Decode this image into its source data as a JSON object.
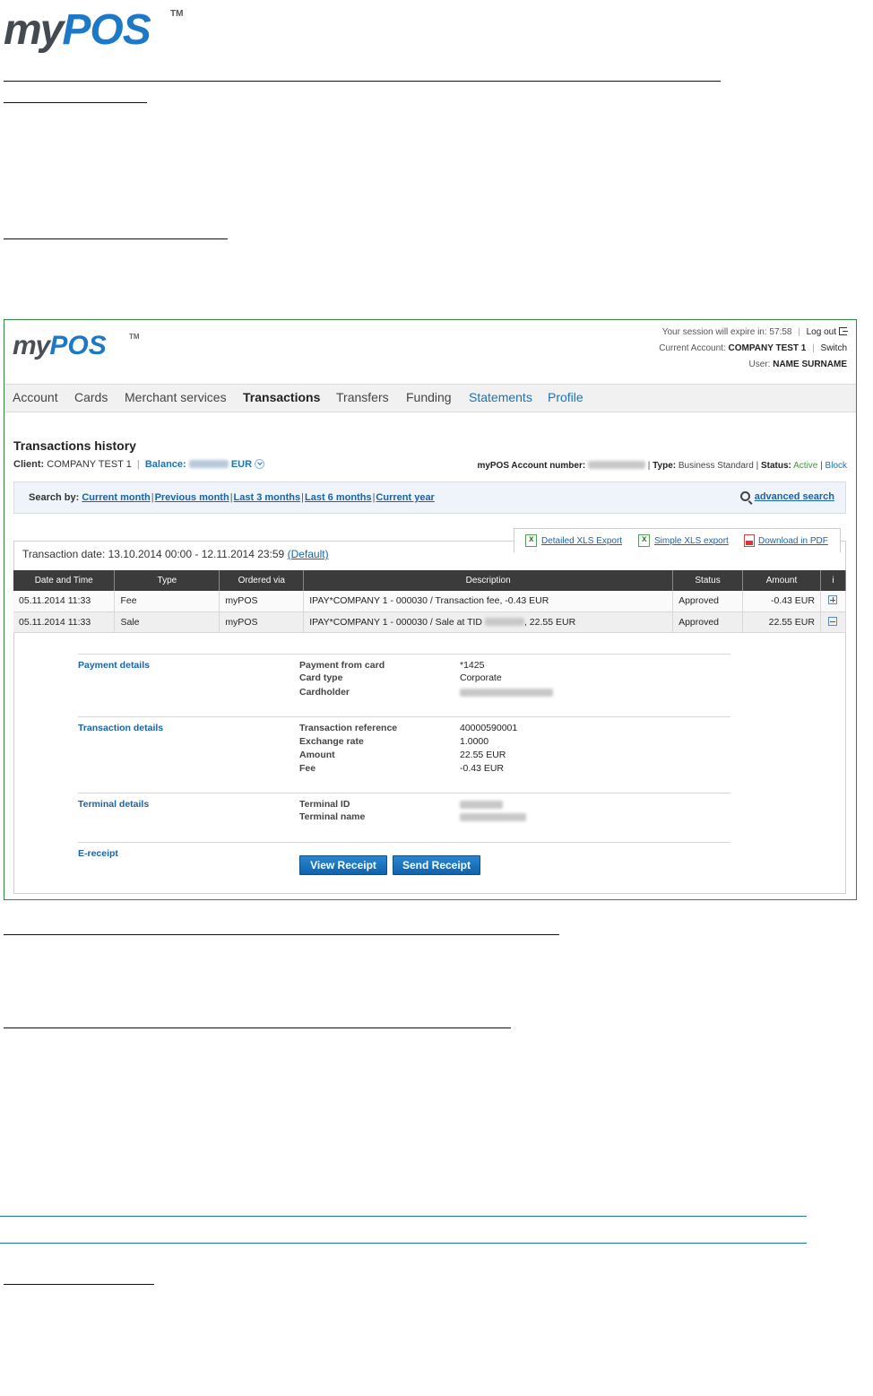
{
  "doc": {
    "logo_my": "my",
    "logo_pos": "POS",
    "logo_tm": "TM"
  },
  "app": {
    "logo_my": "my",
    "logo_pos": "POS",
    "logo_tm": "TM",
    "session": {
      "expire_label": "Your session will expire in:",
      "expire_value": "57:58",
      "logout": "Log out",
      "current_account_label": "Current Account:",
      "current_account": "COMPANY TEST 1",
      "switch": "Switch",
      "user_label": "User:",
      "user": "NAME SURNAME"
    },
    "nav": [
      "Account",
      "Cards",
      "Merchant services",
      "Transactions",
      "Transfers",
      "Funding",
      "Statements",
      "Profile"
    ],
    "page_title": "Transactions history",
    "client": {
      "label": "Client:",
      "value": "COMPANY TEST 1",
      "balance_label": "Balance:",
      "balance_currency": "EUR"
    },
    "account": {
      "number_label": "myPOS Account number:",
      "type_label": "Type:",
      "type": "Business Standard",
      "status_label": "Status:",
      "status": "Active",
      "block": "Block"
    },
    "search": {
      "label": "Search by:",
      "links": [
        "Current month",
        "Previous month",
        "Last 3 months",
        "Last 6 months",
        "Current year"
      ],
      "advanced": "advanced search"
    },
    "exports": {
      "detailed": "Detailed XLS Export",
      "simple": "Simple XLS export",
      "pdf": "Download in PDF"
    },
    "transaction_date": {
      "label": "Transaction date: 13.10.2014 00:00 - 12.11.2014 23:59",
      "default": "(Default)"
    },
    "table": {
      "headers": [
        "Date and Time",
        "Type",
        "Ordered via",
        "Description",
        "Status",
        "Amount",
        "i"
      ],
      "rows": [
        {
          "date": "05.11.2014 11:33",
          "type": "Fee",
          "via": "myPOS",
          "desc": "IPAY*COMPANY 1 - 000030 / Transaction fee, -0.43 EUR",
          "status": "Approved",
          "amount": "-0.43 EUR"
        },
        {
          "date": "05.11.2014 11:33",
          "type": "Sale",
          "via": "myPOS",
          "desc_pre": "IPAY*COMPANY 1 - 000030 / Sale at TID",
          "desc_post": ", 22.55 EUR",
          "status": "Approved",
          "amount": "22.55 EUR"
        }
      ]
    },
    "details": {
      "payment": {
        "title": "Payment details",
        "k1": "Payment from card",
        "v1": "*1425",
        "k2": "Card type",
        "v2": "Corporate",
        "k3": "Cardholder"
      },
      "transaction": {
        "title": "Transaction details",
        "k1": "Transaction reference",
        "v1": "40000590001",
        "k2": "Exchange rate",
        "v2": "1.0000",
        "k3": "Amount",
        "v3": "22.55 EUR",
        "k4": "Fee",
        "v4": "-0.43 EUR"
      },
      "terminal": {
        "title": "Terminal details",
        "k1": "Terminal ID",
        "k2": "Terminal name"
      },
      "ereceipt": {
        "title": "E-receipt",
        "view": "View Receipt",
        "send": "Send Receipt"
      }
    }
  }
}
